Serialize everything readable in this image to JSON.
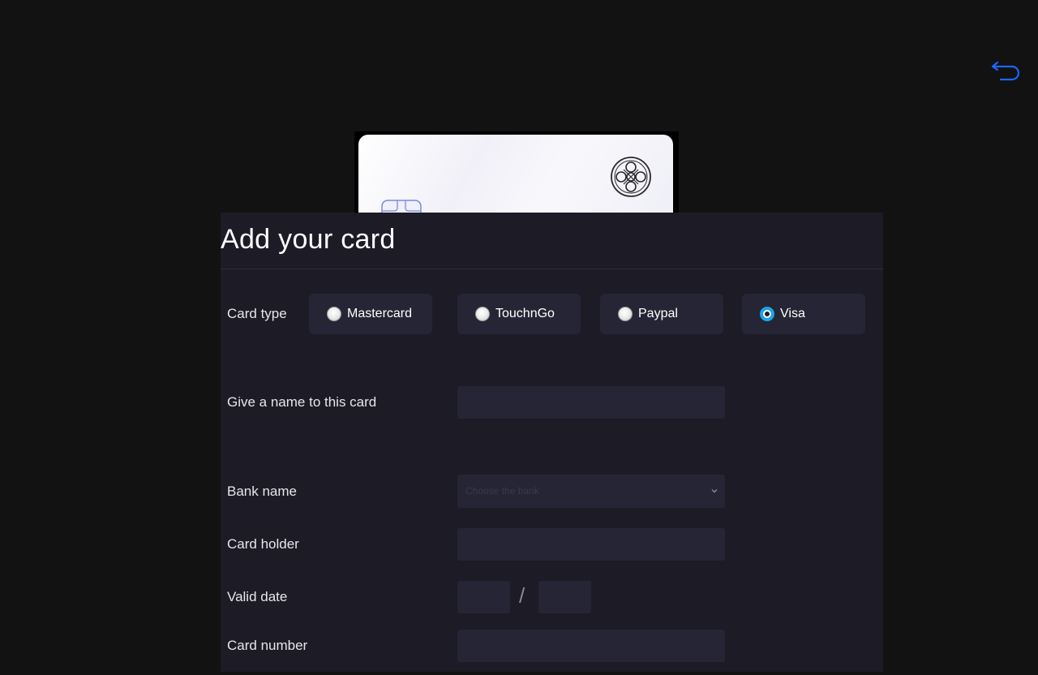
{
  "back_icon": "undo-arrow-icon",
  "accent_color": "#1a66ff",
  "card_preview": {
    "emblem_icon": "celtic-knot-emblem-icon",
    "chip_icon": "card-chip-icon"
  },
  "form": {
    "title": "Add your card",
    "card_type": {
      "label": "Card type",
      "options": [
        {
          "label": "Mastercard",
          "checked": false
        },
        {
          "label": "TouchnGo",
          "checked": false
        },
        {
          "label": "Paypal",
          "checked": false
        },
        {
          "label": "Visa",
          "checked": true
        }
      ]
    },
    "card_name": {
      "label": "Give a name to this card",
      "value": ""
    },
    "bank_name": {
      "label": "Bank name",
      "placeholder": "Choose the bank"
    },
    "card_holder": {
      "label": "Card holder",
      "value": ""
    },
    "valid_date": {
      "label": "Valid date",
      "separator": "/",
      "month": "",
      "year": ""
    },
    "card_number": {
      "label": "Card number",
      "value": ""
    }
  }
}
